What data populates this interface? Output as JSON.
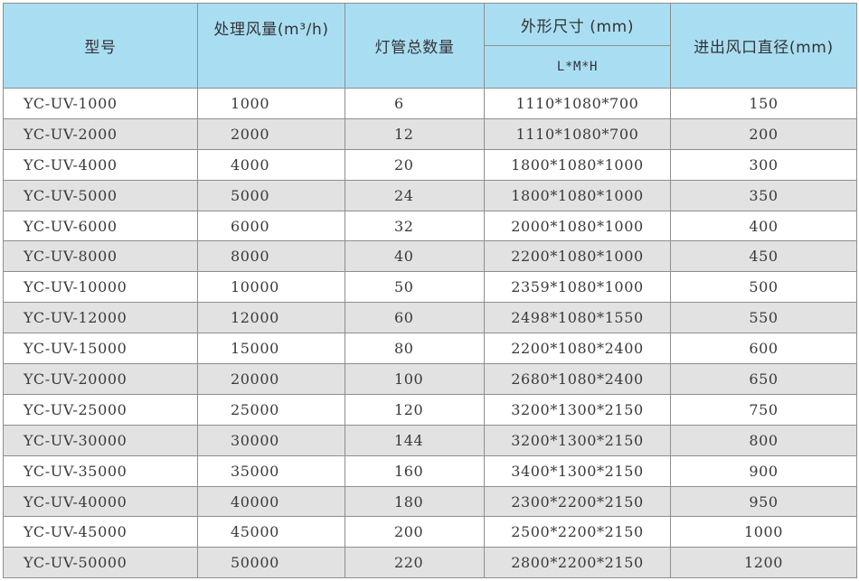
{
  "headers": {
    "model": "型号",
    "airflow": "处理风量(m³/h)",
    "lamps": "灯管总数量",
    "dimensions": "外形尺寸 (mm)",
    "dimensions_sub": "L*M*H",
    "diameter": "进出风口直径(mm)"
  },
  "rows": [
    {
      "model": "YC-UV-1000",
      "airflow": "1000",
      "lamps": "6",
      "dims": "1110*1080*700",
      "dia": "150"
    },
    {
      "model": "YC-UV-2000",
      "airflow": "2000",
      "lamps": "12",
      "dims": "1110*1080*700",
      "dia": "200"
    },
    {
      "model": "YC-UV-4000",
      "airflow": "4000",
      "lamps": "20",
      "dims": "1800*1080*1000",
      "dia": "300"
    },
    {
      "model": "YC-UV-5000",
      "airflow": "5000",
      "lamps": "24",
      "dims": "1800*1080*1000",
      "dia": "350"
    },
    {
      "model": "YC-UV-6000",
      "airflow": "6000",
      "lamps": "32",
      "dims": "2000*1080*1000",
      "dia": "400"
    },
    {
      "model": "YC-UV-8000",
      "airflow": "8000",
      "lamps": "40",
      "dims": "2200*1080*1000",
      "dia": "450"
    },
    {
      "model": "YC-UV-10000",
      "airflow": "10000",
      "lamps": "50",
      "dims": "2359*1080*1000",
      "dia": "500"
    },
    {
      "model": "YC-UV-12000",
      "airflow": "12000",
      "lamps": "60",
      "dims": "2498*1080*1550",
      "dia": "550"
    },
    {
      "model": "YC-UV-15000",
      "airflow": "15000",
      "lamps": "80",
      "dims": "2200*1080*2400",
      "dia": "600"
    },
    {
      "model": "YC-UV-20000",
      "airflow": "20000",
      "lamps": "100",
      "dims": "2680*1080*2400",
      "dia": "650"
    },
    {
      "model": "YC-UV-25000",
      "airflow": "25000",
      "lamps": "120",
      "dims": "3200*1300*2150",
      "dia": "750"
    },
    {
      "model": "YC-UV-30000",
      "airflow": "30000",
      "lamps": "144",
      "dims": "3200*1300*2150",
      "dia": "800"
    },
    {
      "model": "YC-UV-35000",
      "airflow": "35000",
      "lamps": "160",
      "dims": "3400*1300*2150",
      "dia": "900"
    },
    {
      "model": "YC-UV-40000",
      "airflow": "40000",
      "lamps": "180",
      "dims": "2300*2200*2150",
      "dia": "950"
    },
    {
      "model": "YC-UV-45000",
      "airflow": "45000",
      "lamps": "200",
      "dims": "2500*2200*2150",
      "dia": "1000"
    },
    {
      "model": "YC-UV-50000",
      "airflow": "50000",
      "lamps": "220",
      "dims": "2800*2200*2150",
      "dia": "1200"
    }
  ],
  "colors": {
    "header_bg": "#a9def2",
    "row_alt_bg": "#e2e2e2",
    "grid": "#8e8e8e",
    "text": "#3a3a3a"
  }
}
